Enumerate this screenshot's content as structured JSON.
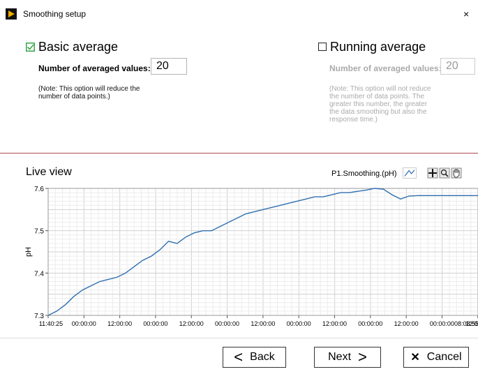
{
  "window": {
    "title": "Smoothing setup",
    "close_glyph": "×"
  },
  "basic": {
    "checked": true,
    "label": "Basic average",
    "field_label": "Number of averaged values:",
    "value": "20",
    "note": "(Note: This option will reduce the number of data points.)"
  },
  "running": {
    "checked": false,
    "label": "Running average",
    "field_label": "Number of averaged values:",
    "value": "20",
    "note": "(Note: This option will not reduce the number of data points. The greater this number, the greater the data smoothing but also the response time.)"
  },
  "live": {
    "title": "Live view",
    "legend": "P1.Smoothing.(pH)"
  },
  "chart_data": {
    "type": "line",
    "ylabel": "pH",
    "xlabel": "",
    "ylim": [
      7.3,
      7.6
    ],
    "yticks": [
      "7.6",
      "7.5",
      "7.4",
      "7.3"
    ],
    "xticks": [
      "11:40:25",
      "00:00:00",
      "12:00:00",
      "00:00:00",
      "12:00:00",
      "00:00:00",
      "12:00:00",
      "00:00:00",
      "12:00:00",
      "00:00:00",
      "12:00:00",
      "00:00:00",
      "12:00:00",
      "08:08:55"
    ],
    "grid": true,
    "series": [
      {
        "color": "#2e6fb0",
        "x": [
          0,
          0.02,
          0.04,
          0.06,
          0.08,
          0.1,
          0.12,
          0.14,
          0.16,
          0.18,
          0.2,
          0.22,
          0.24,
          0.26,
          0.28,
          0.3,
          0.32,
          0.34,
          0.36,
          0.38,
          0.4,
          0.42,
          0.44,
          0.46,
          0.48,
          0.5,
          0.52,
          0.54,
          0.56,
          0.58,
          0.6,
          0.62,
          0.64,
          0.66,
          0.68,
          0.7,
          0.72,
          0.74,
          0.76,
          0.78,
          0.8,
          0.82,
          0.84,
          0.86,
          0.88,
          0.9,
          0.92,
          0.94,
          0.96,
          0.98,
          1.0
        ],
        "y": [
          7.3,
          7.31,
          7.325,
          7.345,
          7.36,
          7.37,
          7.38,
          7.385,
          7.39,
          7.4,
          7.415,
          7.43,
          7.44,
          7.455,
          7.475,
          7.47,
          7.485,
          7.495,
          7.5,
          7.5,
          7.51,
          7.52,
          7.53,
          7.54,
          7.545,
          7.55,
          7.555,
          7.56,
          7.565,
          7.57,
          7.575,
          7.58,
          7.58,
          7.585,
          7.59,
          7.59,
          7.593,
          7.596,
          7.6,
          7.598,
          7.585,
          7.575,
          7.582,
          7.583,
          7.583,
          7.583,
          7.583,
          7.583,
          7.583,
          7.583,
          7.583
        ]
      }
    ]
  },
  "buttons": {
    "back": "Back",
    "back_glyph": "<",
    "next": "Next",
    "next_glyph": ">",
    "cancel": "Cancel",
    "cancel_glyph": "✕"
  },
  "icons": {
    "title_icon": "labview-arrow-icon",
    "check_color": "#3aa64a",
    "accent": "#b04a55"
  }
}
